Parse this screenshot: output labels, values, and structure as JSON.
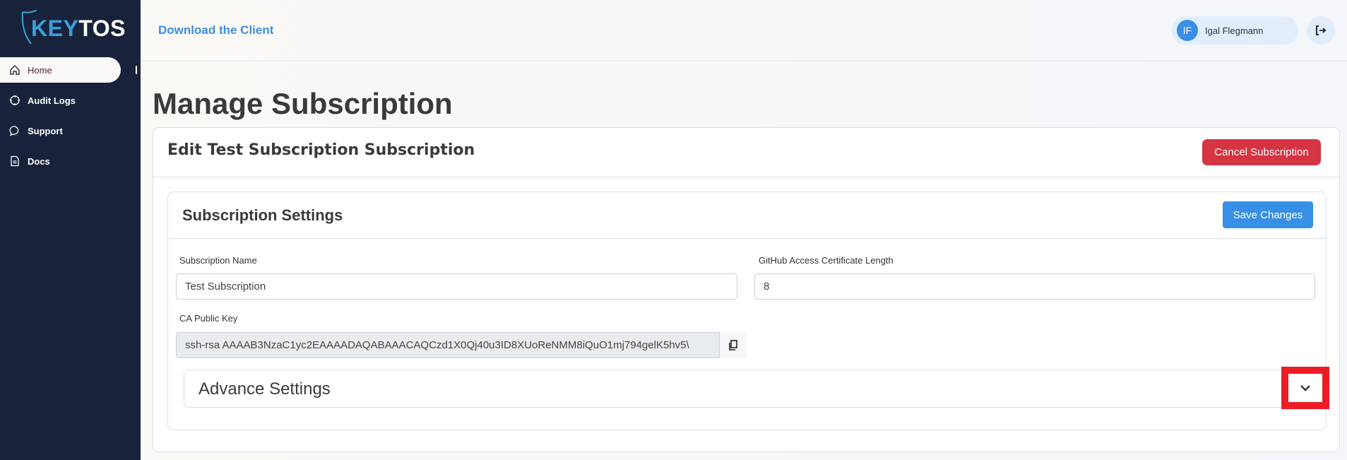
{
  "brand": {
    "logo_text": "KEYTOS",
    "logo_part1": "KEY",
    "logo_part2": "TOS",
    "accent": "#3b9fdc"
  },
  "sidebar": {
    "items": [
      {
        "label": "Home",
        "icon": "home-icon",
        "active": true
      },
      {
        "label": "Audit Logs",
        "icon": "crosshair-icon"
      },
      {
        "label": "Support",
        "icon": "chat-bubble-icon"
      },
      {
        "label": "Docs",
        "icon": "document-icon"
      }
    ]
  },
  "header": {
    "download_link": "Download the Client",
    "user": {
      "initials": "IF",
      "name": "Igal Flegmann"
    },
    "logout_icon": "logout-icon"
  },
  "page": {
    "title": "Manage Subscription"
  },
  "edit_card": {
    "title": "Edit Test Subscription Subscription",
    "cancel_label": "Cancel Subscription",
    "cancel_color": "#d53443"
  },
  "settings": {
    "title": "Subscription Settings",
    "save_label": "Save Changes",
    "save_color": "#378fe6",
    "subscription_name": {
      "label": "Subscription Name",
      "value": "Test Subscription"
    },
    "cert_length": {
      "label": "GitHub Access Certificate Length",
      "value": "8"
    },
    "ca_public_key": {
      "label": "CA Public Key",
      "value": "ssh-rsa AAAAB3NzaC1yc2EAAAADAQABAAACAQCzd1X0Qj40u3ID8XUoReNMM8iQuO1mj794gelK5hv5\\"
    },
    "advanced": {
      "title": "Advance Settings",
      "expand_icon": "chevron-down-icon",
      "highlight_color": "#ed1c24"
    }
  }
}
